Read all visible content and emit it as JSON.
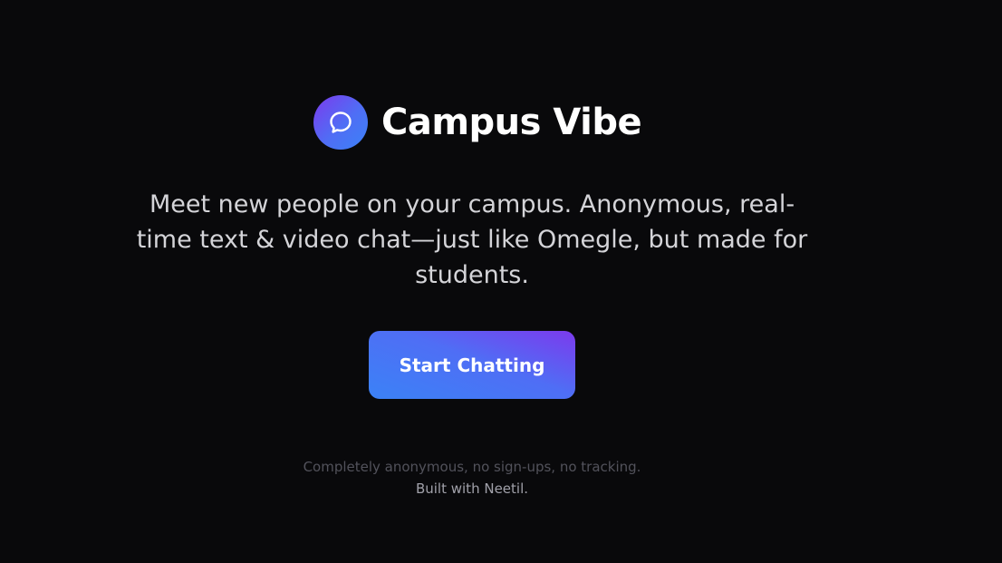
{
  "app": {
    "name": "Campus Vibe",
    "logo_icon": "chat-bubble-icon"
  },
  "hero": {
    "tagline": "Meet new people on your campus. Anonymous, real-time text & video chat—just like Omegle, but made for students.",
    "cta_label": "Start Chatting"
  },
  "footer": {
    "privacy_note": "Completely anonymous, no sign-ups, no tracking.",
    "credit": "Built with Neetil."
  },
  "colors": {
    "background": "#09090b",
    "accent_blue": "#3b82f6",
    "accent_purple": "#7c3aed",
    "text_primary": "#ffffff",
    "text_secondary": "#d4d4d8",
    "text_muted": "#52525b"
  }
}
